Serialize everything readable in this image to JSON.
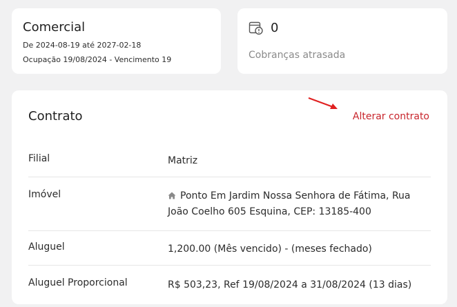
{
  "plan": {
    "title": "Comercial",
    "dates": "De 2024-08-19 até 2027-02-18",
    "occupancy": "Ocupação 19/08/2024 - Vencimento 19"
  },
  "overdue": {
    "count": "0",
    "label": "Cobranças atrasada",
    "icon": "overdue-bill-icon"
  },
  "contract": {
    "title": "Contrato",
    "alter_label": "Alterar contrato",
    "accent_color": "#c8252c",
    "rows": [
      {
        "label": "Filial",
        "value": "Matriz"
      },
      {
        "label": "Imóvel",
        "value": "Ponto Em Jardim Nossa Senhora de Fátima, Rua João Coelho 605 Esquina, CEP: 13185-400",
        "icon": "home-icon"
      },
      {
        "label": "Aluguel",
        "value": "1,200.00 (Mês vencido) - (meses fechado)"
      },
      {
        "label": "Aluguel Proporcional",
        "value": "R$ 503,23, Ref 19/08/2024 a 31/08/2024 (13 dias)"
      }
    ]
  }
}
